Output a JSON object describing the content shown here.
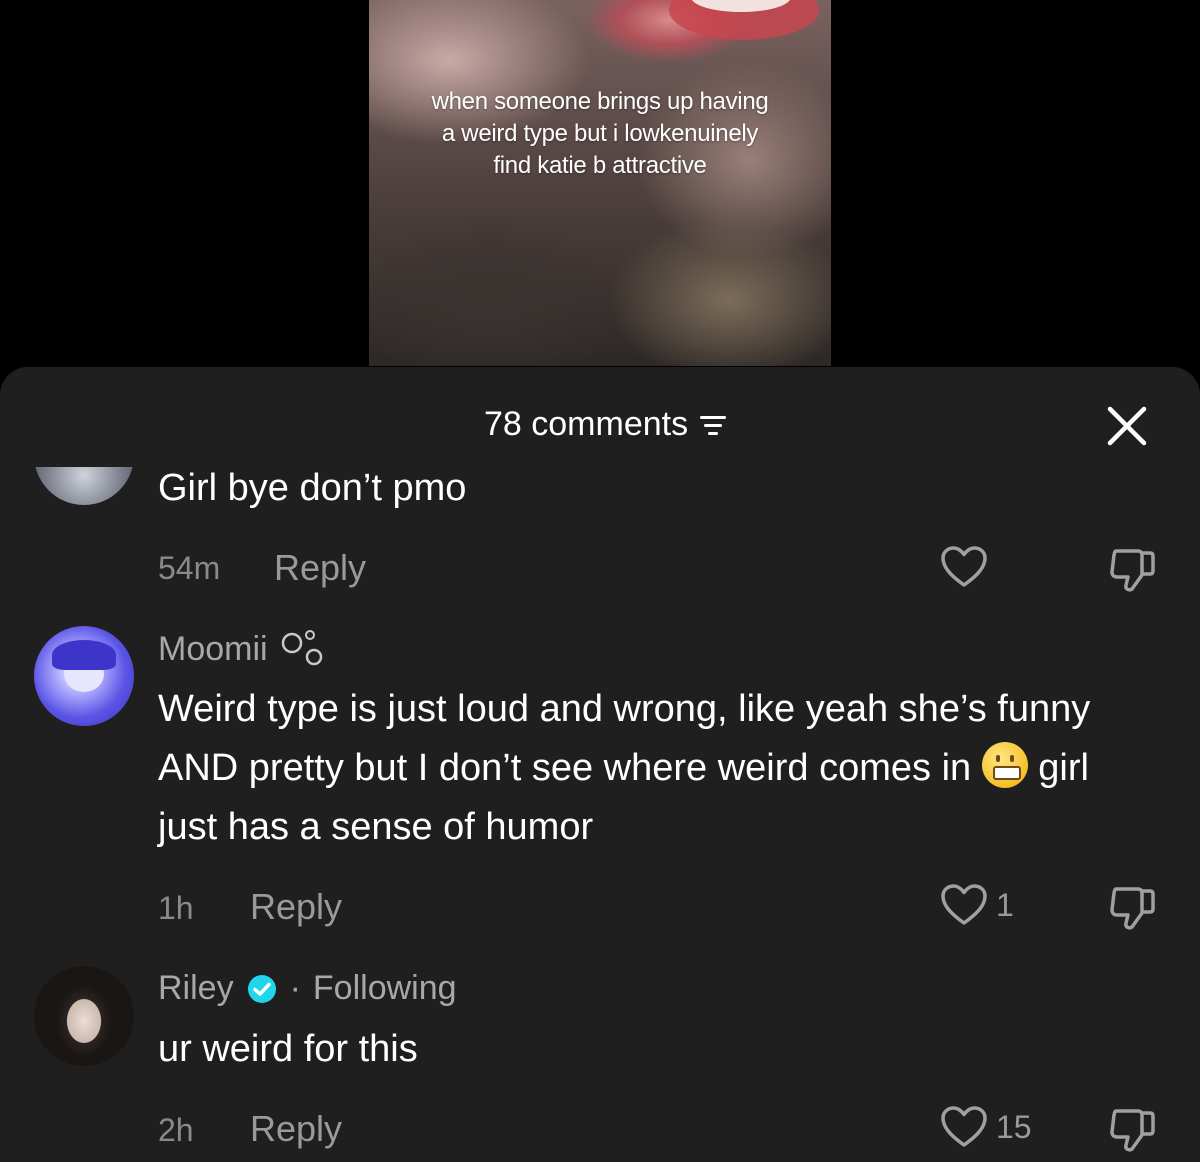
{
  "video": {
    "caption": "when someone brings up having a weird type but i lowkenuinely find katie b attractive"
  },
  "sheet": {
    "title": "78 comments"
  },
  "comments": [
    {
      "text": "Girl bye don’t pmo",
      "time": "54m",
      "reply_label": "Reply",
      "likes": ""
    },
    {
      "username": "Moomii",
      "text_part1": "Weird type is just loud and wrong, like yeah she’s funny AND pretty but I don’t see where weird comes in",
      "text_part2": "girl just has a sense of humor",
      "emoji": "grimacing-face",
      "time": "1h",
      "reply_label": "Reply",
      "likes": "1"
    },
    {
      "username": "Riley",
      "verified": true,
      "separator": "·",
      "following_label": "Following",
      "text": "ur weird for this",
      "time": "2h",
      "reply_label": "Reply",
      "likes": "15"
    }
  ],
  "colors": {
    "background": "#000000",
    "sheet": "#1f1f1f",
    "verified_badge": "#20d5ec",
    "secondary_text": "#8a8a8a"
  }
}
